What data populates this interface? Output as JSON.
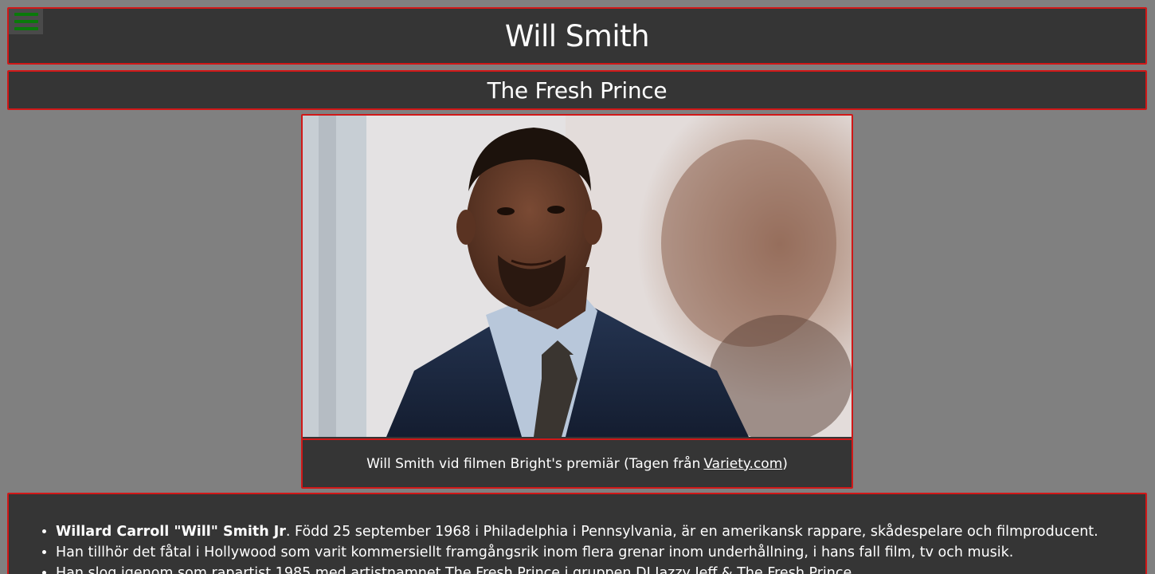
{
  "header": {
    "title": "Will Smith",
    "menu_icon": "hamburger-menu-icon",
    "menu_color": "#0a7a0a"
  },
  "subheader": {
    "title": "The Fresh Prince"
  },
  "figure": {
    "image_alt": "Will Smith",
    "caption_text": "Will Smith vid filmen Bright's premiär (Tagen från",
    "caption_link": "Variety.com",
    "caption_suffix": ")"
  },
  "bio": {
    "items": [
      {
        "bold": "Willard Carroll \"Will\" Smith Jr",
        "text": ". Född 25 september 1968 i Philadelphia i Pennsylvania, är en amerikansk rappare, skådespelare och filmproducent."
      },
      {
        "bold": "",
        "text": "Han tillhör det fåtal i Hollywood som varit kommersiellt framgångsrik inom flera grenar inom underhållning, i hans fall film, tv och musik."
      },
      {
        "bold": "",
        "text": "Han slog igenom som rapartist 1985 med artistnamnet The Fresh Prince i gruppen DJ Jazzy Jeff & The Fresh Prince."
      }
    ]
  },
  "colors": {
    "background": "#808080",
    "panel": "#353535",
    "border": "#d01818",
    "text": "#ffffff"
  }
}
